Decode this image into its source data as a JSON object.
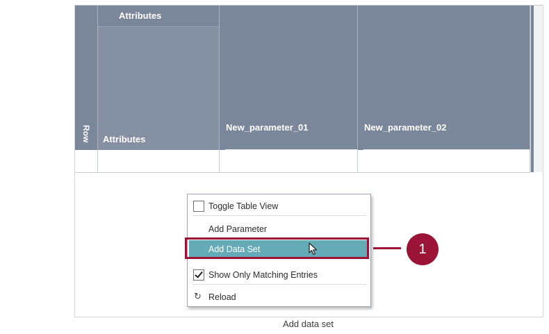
{
  "table": {
    "row_header": "Row",
    "attributes_group": "Attributes",
    "attributes_column": "Attributes",
    "parameters": [
      "New_parameter_01",
      "New_parameter_02"
    ]
  },
  "context_menu": {
    "items": [
      {
        "label": "Toggle Table View",
        "type": "checkbox",
        "checked": false
      },
      {
        "label": "Add Parameter",
        "type": "action"
      },
      {
        "label": "Add Data Set",
        "type": "action",
        "highlighted": true
      },
      {
        "label": "Show Only Matching Entries",
        "type": "checkbox",
        "checked": true
      },
      {
        "label": "Reload",
        "type": "action",
        "icon": "reload-icon"
      }
    ]
  },
  "callout": {
    "number": "1",
    "color": "#9b1438"
  },
  "colors": {
    "header": "#7a879b",
    "highlight": "#64aab7",
    "accent": "#9b1438"
  },
  "caption": "Add data set"
}
